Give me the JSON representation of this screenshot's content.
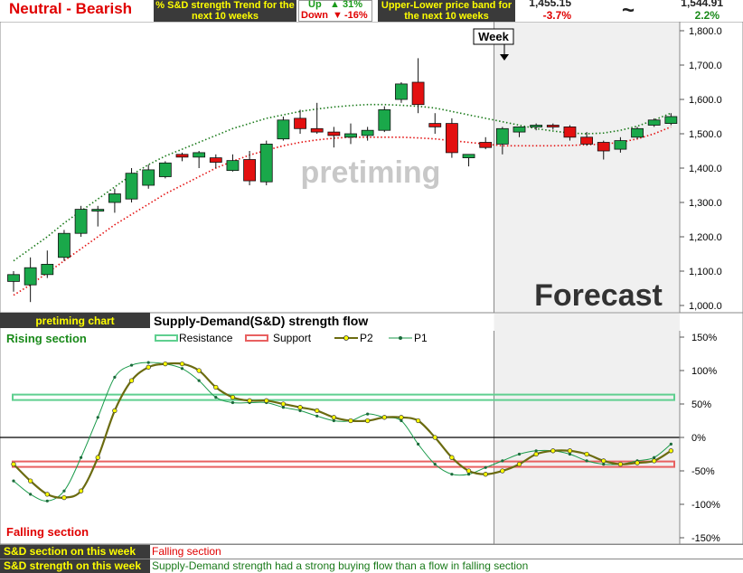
{
  "header": {
    "trend_label": "Neutral - Bearish",
    "sd_trend_title": "% S&D strength Trend for the next 10 weeks",
    "up_label": "Up",
    "up_value": "31%",
    "down_label": "Down",
    "down_value": "-16%",
    "band_title": "Upper-Lower price band for the next 10 weeks",
    "lower_price": "1,455.15",
    "lower_change": "-3.7%",
    "tilde": "~",
    "upper_price": "1,544.91",
    "upper_change": "2.2%"
  },
  "colors": {
    "bull": "#1aa84a",
    "bear": "#e31010",
    "upper_band": "#1a7a1a",
    "lower_band": "#e31010",
    "resistance": "#5fcf8f",
    "support": "#e86060",
    "p2": "#6b6b10",
    "p1": "#1a9a4a",
    "forecast_bg": "#f0f0f0",
    "label_bg": "#3a3a3a",
    "label_fg": "#ffff00"
  },
  "chart_data": [
    {
      "type": "candlestick",
      "period_label": "Week",
      "watermark": "pretiming",
      "forecast_label": "Forecast",
      "y_ticks": [
        "1,800.0",
        "1,700.0",
        "1,600.0",
        "1,500.0",
        "1,400.0",
        "1,300.0",
        "1,200.0",
        "1,100.0",
        "1,000.0"
      ],
      "ylim": [
        1000,
        1800
      ],
      "forecast_start_index": 29,
      "candles": [
        {
          "o": 1070,
          "h": 1100,
          "l": 1040,
          "c": 1090
        },
        {
          "o": 1060,
          "h": 1140,
          "l": 1010,
          "c": 1110
        },
        {
          "o": 1090,
          "h": 1160,
          "l": 1080,
          "c": 1120
        },
        {
          "o": 1140,
          "h": 1220,
          "l": 1130,
          "c": 1210
        },
        {
          "o": 1210,
          "h": 1290,
          "l": 1200,
          "c": 1280
        },
        {
          "o": 1275,
          "h": 1290,
          "l": 1230,
          "c": 1280
        },
        {
          "o": 1300,
          "h": 1340,
          "l": 1270,
          "c": 1325
        },
        {
          "o": 1310,
          "h": 1400,
          "l": 1300,
          "c": 1385
        },
        {
          "o": 1350,
          "h": 1410,
          "l": 1340,
          "c": 1395
        },
        {
          "o": 1375,
          "h": 1420,
          "l": 1370,
          "c": 1415
        },
        {
          "o": 1440,
          "h": 1445,
          "l": 1420,
          "c": 1432
        },
        {
          "o": 1432,
          "h": 1450,
          "l": 1400,
          "c": 1445
        },
        {
          "o": 1430,
          "h": 1440,
          "l": 1400,
          "c": 1417
        },
        {
          "o": 1393,
          "h": 1440,
          "l": 1390,
          "c": 1422
        },
        {
          "o": 1425,
          "h": 1450,
          "l": 1350,
          "c": 1363
        },
        {
          "o": 1360,
          "h": 1480,
          "l": 1350,
          "c": 1470
        },
        {
          "o": 1485,
          "h": 1550,
          "l": 1480,
          "c": 1540
        },
        {
          "o": 1545,
          "h": 1570,
          "l": 1500,
          "c": 1515
        },
        {
          "o": 1515,
          "h": 1590,
          "l": 1500,
          "c": 1505
        },
        {
          "o": 1505,
          "h": 1520,
          "l": 1460,
          "c": 1495
        },
        {
          "o": 1490,
          "h": 1530,
          "l": 1470,
          "c": 1500
        },
        {
          "o": 1495,
          "h": 1520,
          "l": 1480,
          "c": 1510
        },
        {
          "o": 1510,
          "h": 1580,
          "l": 1505,
          "c": 1570
        },
        {
          "o": 1600,
          "h": 1650,
          "l": 1590,
          "c": 1645
        },
        {
          "o": 1650,
          "h": 1720,
          "l": 1560,
          "c": 1585
        },
        {
          "o": 1530,
          "h": 1560,
          "l": 1500,
          "c": 1520
        },
        {
          "o": 1530,
          "h": 1545,
          "l": 1430,
          "c": 1445
        },
        {
          "o": 1430,
          "h": 1440,
          "l": 1405,
          "c": 1440
        },
        {
          "o": 1475,
          "h": 1490,
          "l": 1455,
          "c": 1460
        },
        {
          "o": 1470,
          "h": 1520,
          "l": 1440,
          "c": 1515
        },
        {
          "o": 1505,
          "h": 1520,
          "l": 1490,
          "c": 1520
        },
        {
          "o": 1520,
          "h": 1530,
          "l": 1510,
          "c": 1525
        },
        {
          "o": 1525,
          "h": 1530,
          "l": 1512,
          "c": 1520
        },
        {
          "o": 1520,
          "h": 1525,
          "l": 1480,
          "c": 1490
        },
        {
          "o": 1490,
          "h": 1505,
          "l": 1465,
          "c": 1470
        },
        {
          "o": 1475,
          "h": 1480,
          "l": 1425,
          "c": 1450
        },
        {
          "o": 1455,
          "h": 1490,
          "l": 1445,
          "c": 1480
        },
        {
          "o": 1490,
          "h": 1520,
          "l": 1485,
          "c": 1515
        },
        {
          "o": 1525,
          "h": 1545,
          "l": 1520,
          "c": 1540
        },
        {
          "o": 1530,
          "h": 1560,
          "l": 1525,
          "c": 1550
        }
      ],
      "upper_band": [
        1130,
        1165,
        1200,
        1240,
        1275,
        1310,
        1345,
        1380,
        1410,
        1435,
        1455,
        1475,
        1495,
        1515,
        1530,
        1545,
        1555,
        1565,
        1572,
        1578,
        1582,
        1585,
        1585,
        1583,
        1580,
        1575,
        1565,
        1555,
        1545,
        1535,
        1525,
        1515,
        1508,
        1502,
        1500,
        1502,
        1510,
        1522,
        1540,
        1560
      ],
      "lower_band": [
        1030,
        1060,
        1095,
        1130,
        1165,
        1200,
        1235,
        1265,
        1295,
        1325,
        1350,
        1375,
        1400,
        1420,
        1438,
        1452,
        1465,
        1475,
        1482,
        1487,
        1490,
        1490,
        1490,
        1490,
        1488,
        1485,
        1480,
        1475,
        1470,
        1465,
        1465,
        1465,
        1465,
        1466,
        1468,
        1470,
        1475,
        1485,
        1500,
        1520
      ]
    },
    {
      "type": "line",
      "title": "Supply-Demand(S&D)  strength flow",
      "rising_label": "Rising section",
      "falling_label": "Falling section",
      "legend": [
        "Resistance",
        "Support",
        "P2",
        "P1"
      ],
      "y_ticks": [
        "150%",
        "100%",
        "50%",
        "0%",
        "-50%",
        "-100%",
        "-150%"
      ],
      "ylim": [
        -150,
        150
      ],
      "resistance": 60,
      "support": -40,
      "series": [
        {
          "name": "P2",
          "values": [
            -40,
            -65,
            -85,
            -90,
            -80,
            -30,
            40,
            85,
            105,
            110,
            110,
            100,
            75,
            60,
            55,
            55,
            50,
            45,
            40,
            30,
            25,
            25,
            30,
            30,
            25,
            0,
            -30,
            -50,
            -55,
            -50,
            -40,
            -25,
            -20,
            -20,
            -25,
            -35,
            -40,
            -38,
            -35,
            -20
          ]
        },
        {
          "name": "P1",
          "values": [
            -65,
            -85,
            -95,
            -80,
            -30,
            30,
            90,
            108,
            112,
            110,
            103,
            85,
            60,
            52,
            52,
            52,
            45,
            40,
            32,
            25,
            25,
            35,
            30,
            25,
            -10,
            -40,
            -55,
            -55,
            -45,
            -35,
            -25,
            -20,
            -20,
            -25,
            -35,
            -40,
            -40,
            -35,
            -30,
            -10
          ]
        }
      ]
    }
  ],
  "footer": {
    "chart_label": "pretiming chart",
    "section_label": "S&D section on this week",
    "section_value": "Falling section",
    "strength_label": "S&D strength on this week",
    "strength_value": "Supply-Demand strength had a strong buying flow than a flow in falling section"
  }
}
